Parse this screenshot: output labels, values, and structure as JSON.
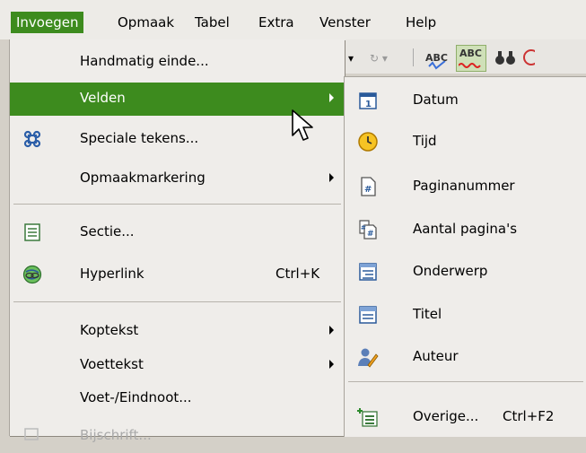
{
  "menubar": {
    "items": [
      {
        "label": "Invoegen",
        "active": true
      },
      {
        "label": "Opmaak"
      },
      {
        "label": "Tabel"
      },
      {
        "label": "Extra"
      },
      {
        "label": "Venster"
      },
      {
        "label": "Help"
      }
    ]
  },
  "toolbar": {
    "spell_label": "ABC",
    "autospell_label": "ABC"
  },
  "insert_menu": {
    "items": [
      {
        "label": "Handmatig einde..."
      },
      {
        "label": "Velden",
        "highlighted": true,
        "submenu": true
      },
      {
        "label": "Speciale tekens...",
        "icon": "special-characters-icon"
      },
      {
        "label": "Opmaakmarkering",
        "submenu": true
      },
      {
        "label": "Sectie...",
        "icon": "section-icon"
      },
      {
        "label": "Hyperlink",
        "shortcut": "Ctrl+K",
        "icon": "hyperlink-icon"
      },
      {
        "label": "Koptekst",
        "submenu": true
      },
      {
        "label": "Voettekst",
        "submenu": true
      },
      {
        "label": "Voet-/Eindnoot..."
      },
      {
        "label": "Bijschrift...",
        "faded": true
      }
    ]
  },
  "fields_submenu": {
    "items": [
      {
        "label": "Datum",
        "icon": "calendar-icon"
      },
      {
        "label": "Tijd",
        "icon": "clock-icon"
      },
      {
        "label": "Paginanummer",
        "icon": "page-number-icon"
      },
      {
        "label": "Aantal pagina's",
        "icon": "page-count-icon"
      },
      {
        "label": "Onderwerp",
        "icon": "subject-icon"
      },
      {
        "label": "Titel",
        "icon": "title-icon"
      },
      {
        "label": "Auteur",
        "icon": "author-icon"
      },
      {
        "label": "Overige...",
        "shortcut": "Ctrl+F2",
        "icon": "other-fields-icon"
      }
    ]
  },
  "colors": {
    "highlight": "#3d8b1e",
    "menu_bg": "#efedea"
  }
}
